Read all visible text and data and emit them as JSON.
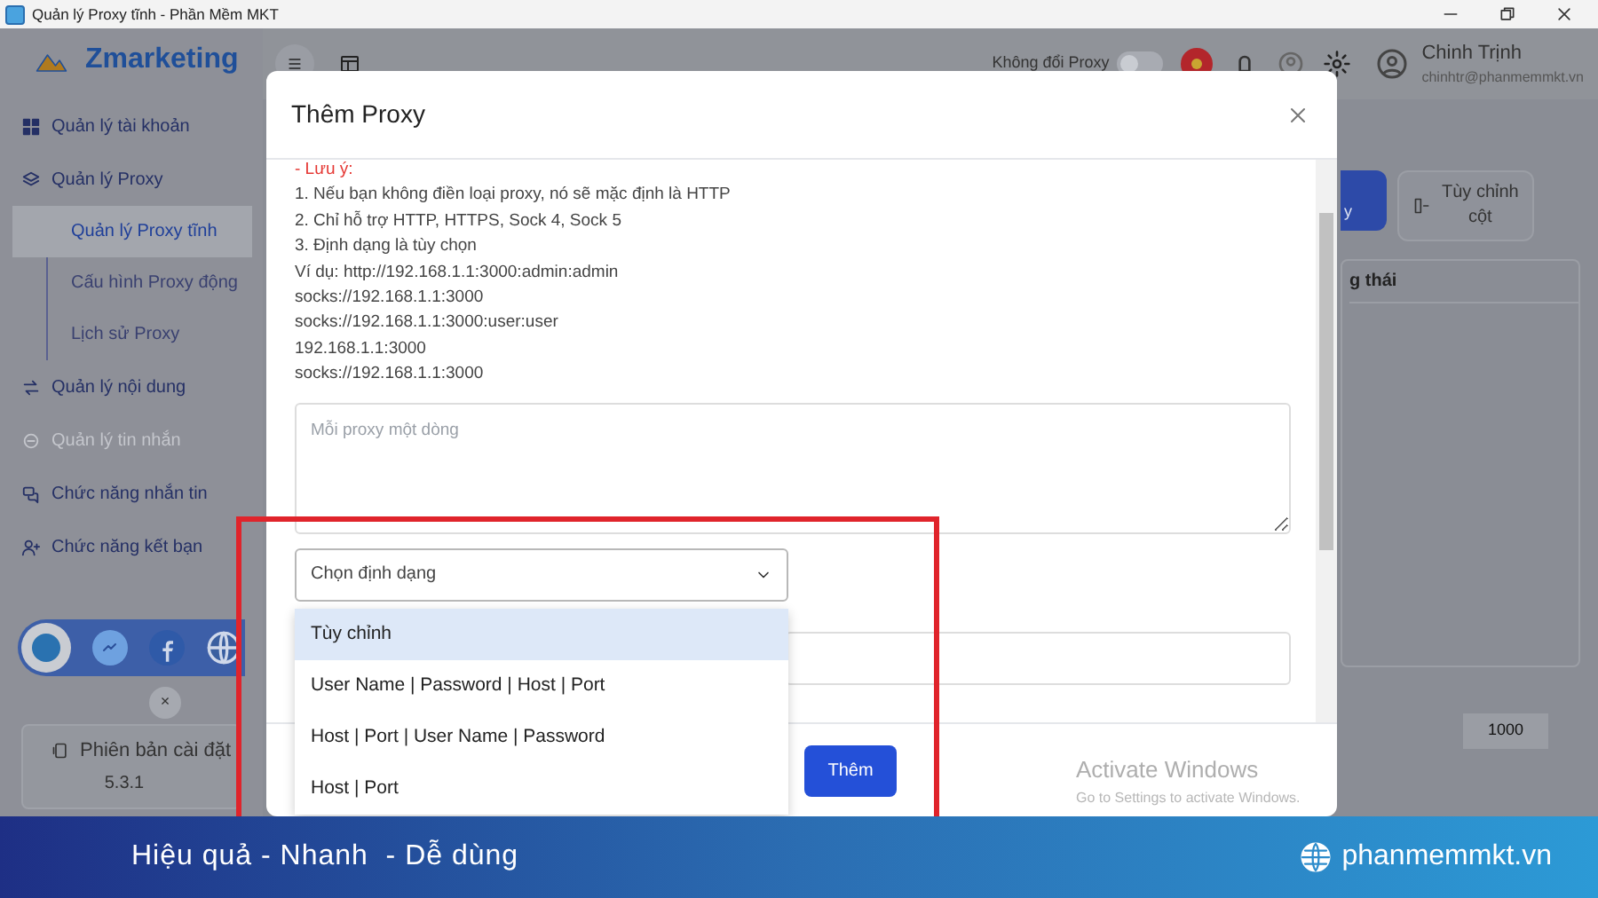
{
  "window": {
    "title": "Quản lý Proxy tĩnh - Phần Mềm MKT"
  },
  "brand": {
    "name": "Zmarketing"
  },
  "sidebar": {
    "items": [
      {
        "label": "Quản lý tài khoản",
        "selected": false,
        "disabled": false
      },
      {
        "label": "Quản lý Proxy",
        "selected": false,
        "disabled": false,
        "expanded": true,
        "children": [
          {
            "label": "Quản lý Proxy tĩnh",
            "selected": true
          },
          {
            "label": "Cấu hình Proxy động",
            "selected": false
          },
          {
            "label": "Lịch sử Proxy",
            "selected": false
          }
        ]
      },
      {
        "label": "Quản lý nội dung",
        "selected": false,
        "disabled": false
      },
      {
        "label": "Quản lý tin nhắn",
        "selected": false,
        "disabled": true
      },
      {
        "label": "Chức năng nhắn tin",
        "selected": false,
        "disabled": false
      },
      {
        "label": "Chức năng kết bạn",
        "selected": false,
        "disabled": false
      }
    ],
    "close_symbol": "×",
    "version": {
      "label": "Phiên bản cài đặt",
      "value": "5.3.1"
    }
  },
  "header": {
    "proxy_toggle": {
      "label": "Không đổi Proxy",
      "on": false
    },
    "user": {
      "name": "Chinh Trịnh",
      "email": "chinhtr@phanmemmkt.vn"
    }
  },
  "page": {
    "buttons": [
      "y",
      "Tùy chỉnh\ncột"
    ],
    "column_header": "g thái",
    "page_size": "1000"
  },
  "modal": {
    "title": "Thêm Proxy",
    "notes": [
      {
        "text": "- Lưu ý:",
        "kind": "warning"
      },
      {
        "text": "1. Nếu bạn không điền loại proxy, nó sẽ mặc định là HTTP",
        "kind": "plain"
      },
      {
        "text": "2. Chỉ hỗ trợ HTTP, HTTPS, Sock 4, Sock 5",
        "kind": "plain"
      },
      {
        "text": "3. Định dạng là tùy chọn",
        "kind": "plain"
      },
      {
        "text": "Ví dụ: http://192.168.1.1:3000:admin:admin",
        "kind": "plain"
      },
      {
        "text": "socks://192.168.1.1:3000",
        "kind": "plain"
      },
      {
        "text": "socks://192.168.1.1:3000:user:user",
        "kind": "plain"
      },
      {
        "text": "192.168.1.1:3000",
        "kind": "plain"
      },
      {
        "text": "socks://192.168.1.1:3000",
        "kind": "plain"
      }
    ],
    "proxy_input": {
      "placeholder": "Mỗi proxy một dòng"
    },
    "format_select": {
      "placeholder": "Chọn định dạng",
      "expanded": true,
      "options": [
        {
          "label": "Tùy chỉnh",
          "selected": true
        },
        {
          "label": "User Name | Password | Host | Port",
          "selected": false
        },
        {
          "label": "Host | Port | User Name | Password",
          "selected": false
        },
        {
          "label": "Host | Port",
          "selected": false
        }
      ]
    },
    "submit_button": "Thêm"
  },
  "os_notice": {
    "title": "Activate Windows",
    "subtitle": "Go to Settings to activate Windows."
  },
  "banner": {
    "slogan": "Hiệu quả - Nhanh  - Dễ dùng",
    "site": "phanmemmkt.vn"
  }
}
